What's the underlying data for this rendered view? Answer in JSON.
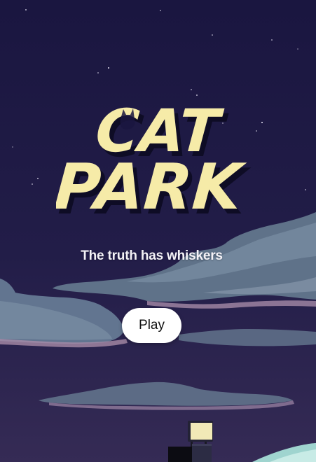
{
  "game": {
    "title_line1": "CAT",
    "title_line2": "PARK",
    "tagline": "The truth has whiskers",
    "play_label": "Play"
  },
  "colors": {
    "sky_top": "#1a1640",
    "sky_bottom": "#332952",
    "logo_fill": "#f6eba8",
    "logo_shadow": "#0e0c24",
    "cloud": "#687c92",
    "cloud_pink": "#9b87a3",
    "button_bg": "#ffffff"
  }
}
